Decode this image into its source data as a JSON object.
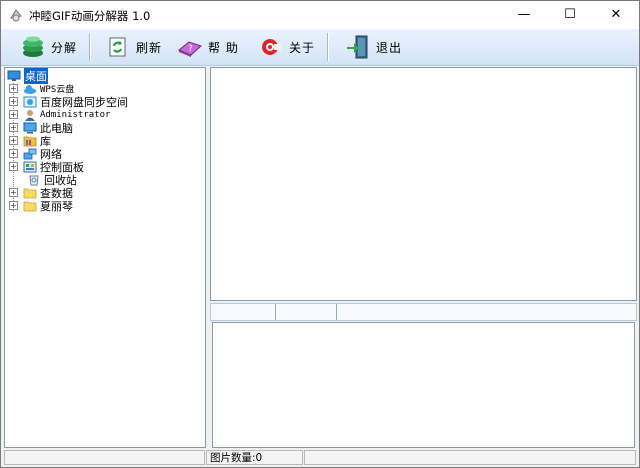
{
  "window": {
    "title": "冲睦GIF动画分解器 1.0",
    "minimize_glyph": "—",
    "maximize_glyph": "☐",
    "close_glyph": "✕"
  },
  "toolbar": {
    "split_label": "分解",
    "refresh_label": "刷新",
    "help_label": "帮 助",
    "about_label": "关于",
    "exit_label": "退出"
  },
  "tree": {
    "root": {
      "label": "桌面",
      "icon": "desktop-icon"
    },
    "items": [
      {
        "label": "WPS云盘",
        "icon": "cloud-icon",
        "expandable": true
      },
      {
        "label": "百度网盘同步空间",
        "icon": "baidu-sync-icon",
        "expandable": true
      },
      {
        "label": "Administrator",
        "icon": "user-icon",
        "expandable": true
      },
      {
        "label": "此电脑",
        "icon": "computer-icon",
        "expandable": true
      },
      {
        "label": "库",
        "icon": "library-folder-icon",
        "expandable": true
      },
      {
        "label": "网络",
        "icon": "network-icon",
        "expandable": true
      },
      {
        "label": "控制面板",
        "icon": "control-panel-icon",
        "expandable": true
      },
      {
        "label": "回收站",
        "icon": "recycle-bin-icon",
        "expandable": false
      },
      {
        "label": "查数据",
        "icon": "folder-icon",
        "expandable": true
      },
      {
        "label": "夏丽琴",
        "icon": "folder-icon",
        "expandable": true
      }
    ],
    "expand_glyph": "+"
  },
  "status": {
    "panel1": "",
    "image_count": "图片数量:0",
    "panel3": ""
  },
  "colors": {
    "selection": "#0a64d2",
    "toolbar_top": "#eaf3ff",
    "toolbar_bottom": "#d3e3f7",
    "folder": "#ffd965"
  }
}
